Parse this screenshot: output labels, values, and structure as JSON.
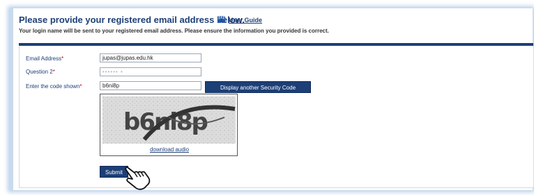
{
  "header": {
    "title": "Please provide your registered email address below.",
    "guide_link": "User Guide",
    "subtitle": "Your login name will be sent to your registered email address. Please ensure the information you provided is correct."
  },
  "form": {
    "email_label": "Email Address",
    "email_value": "jupas@jupas.edu.hk",
    "question_label": "Question 2",
    "question_value": "•••••• •",
    "code_label": "Enter the code shown",
    "code_value": "b6ni8p",
    "required_mark": "*",
    "security_button": "Display another Security Code",
    "captcha_text": "b6ni8p",
    "audio_link": "download audio",
    "submit_button": "Submit"
  },
  "colors": {
    "brand": "#1d3f77",
    "required": "#cc0000"
  },
  "icons": {
    "guide": "book-icon",
    "cursor": "hand-pointer-icon"
  }
}
